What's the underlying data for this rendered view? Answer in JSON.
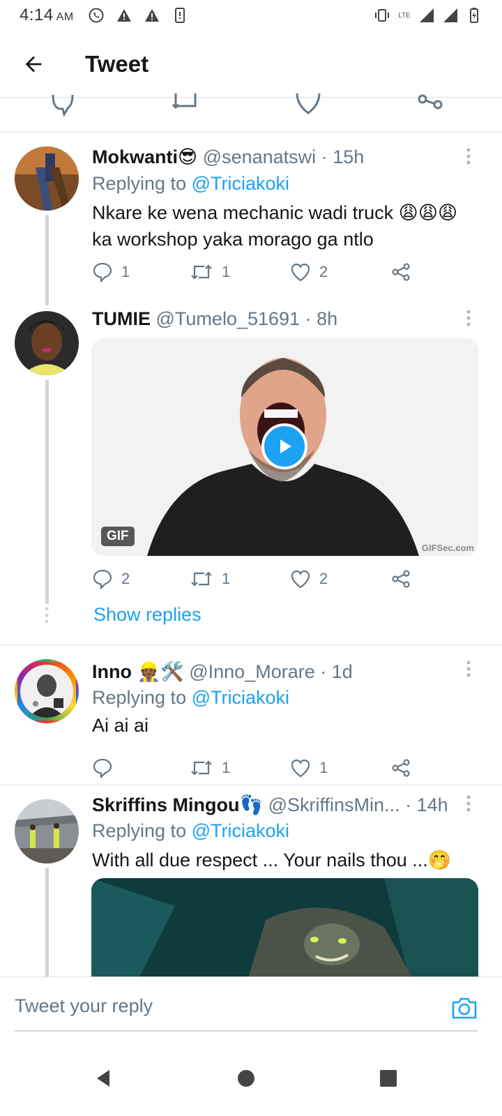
{
  "status_bar": {
    "time": "4:14",
    "ampm": "AM",
    "lte": "LTE"
  },
  "app_bar": {
    "title": "Tweet"
  },
  "tweets": [
    {
      "name": "Mokwanti😎",
      "handle": "@senanatswi",
      "time": "· 15h",
      "replying_prefix": "Replying to ",
      "replying_to": "@Triciakoki",
      "text": "Nkare ke wena mechanic wadi truck 😩😩😩 ka workshop yaka morago ga ntlo",
      "replies": "1",
      "retweets": "1",
      "likes": "2"
    },
    {
      "name": "TUMIE",
      "handle": "@Tumelo_51691",
      "time": "· 8h",
      "gif_label": "GIF",
      "gif_watermark": "GIFSec.com",
      "replies": "2",
      "retweets": "1",
      "likes": "2",
      "show_replies": "Show replies"
    },
    {
      "name": "Inno 👷🏾🛠️",
      "handle": "@Inno_Morare",
      "time": "· 1d",
      "replying_prefix": "Replying to ",
      "replying_to": "@Triciakoki",
      "text": "Ai ai ai",
      "replies": "",
      "retweets": "1",
      "likes": "1"
    },
    {
      "name": "Skriffins Mingou👣",
      "handle": "@SkriffinsMin...",
      "time": "· 14h",
      "replying_prefix": "Replying to ",
      "replying_to": "@Triciakoki",
      "text": "With all due respect ... Your nails thou ...🤭"
    }
  ],
  "composer": {
    "placeholder": "Tweet your reply"
  },
  "colors": {
    "accent": "#1da1f2",
    "secondary_text": "#657786",
    "divider": "#dcdfe2"
  }
}
